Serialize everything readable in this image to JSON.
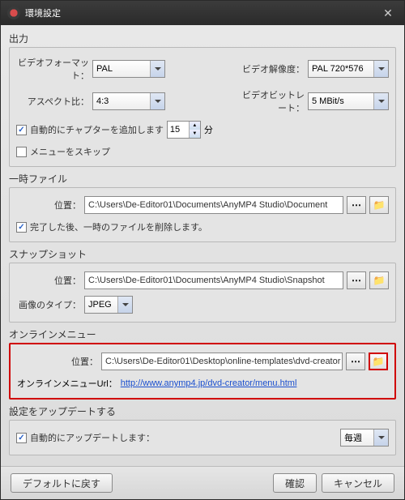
{
  "window": {
    "title": "環境設定"
  },
  "output": {
    "section": "出力",
    "video_format_label": "ビデオフォーマット：",
    "video_format_value": "PAL",
    "aspect_label": "アスペクト比：",
    "aspect_value": "4:3",
    "resolution_label": "ビデオ解像度：",
    "resolution_value": "PAL 720*576",
    "bitrate_label": "ビデオビットレート：",
    "bitrate_value": "5 MBit/s",
    "auto_chapter_label": "自動的にチャプターを追加します",
    "auto_chapter_value": "15",
    "auto_chapter_unit": "分",
    "skip_menu_label": "メニューをスキップ"
  },
  "tempfile": {
    "section": "一時ファイル",
    "path_label": "位置：",
    "path_value": "C:\\Users\\De-Editor01\\Documents\\AnyMP4 Studio\\Document",
    "delete_label": "完了した後、一時のファイルを削除します。"
  },
  "snapshot": {
    "section": "スナップショット",
    "path_label": "位置：",
    "path_value": "C:\\Users\\De-Editor01\\Documents\\AnyMP4 Studio\\Snapshot",
    "type_label": "画像のタイプ：",
    "type_value": "JPEG"
  },
  "online_menu": {
    "section": "オンラインメニュー",
    "path_label": "位置：",
    "path_value": "C:\\Users\\De-Editor01\\Desktop\\online-templates\\dvd-creator",
    "url_label": "オンラインメニューUrl：",
    "url_value": "http://www.anymp4.jp/dvd-creator/menu.html"
  },
  "update": {
    "section": "設定をアップデートする",
    "auto_label": "自動的にアップデートします：",
    "freq_value": "毎週"
  },
  "footer": {
    "default": "デフォルトに戻す",
    "ok": "確認",
    "cancel": "キャンセル"
  }
}
